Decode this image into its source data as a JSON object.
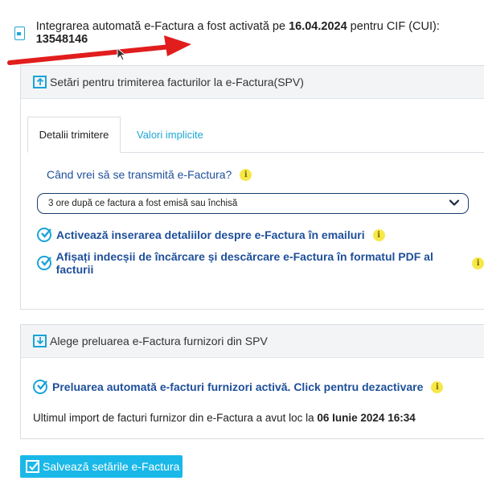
{
  "banner": {
    "text_prefix": "Integrarea automată e-Factura a fost activată pe ",
    "date": "16.04.2024",
    "text_mid": " pentru CIF (CUI): ",
    "cif": "13548146"
  },
  "send_panel": {
    "title": "Setări pentru trimiterea facturilor la e-Factura(SPV)",
    "tabs": [
      {
        "label": "Detalii trimitere",
        "active": true
      },
      {
        "label": "Valori implicite",
        "active": false
      }
    ],
    "question": "Când vrei să se transmită e-Factura?",
    "select_value": "3 ore după ce factura a fost emisă sau închisă",
    "options": [
      {
        "label": "Activează inserarea detaliilor despre e-Factura în emailuri",
        "checked": true
      },
      {
        "label": "Afișați indecșii de încărcare și descărcare e-Factura în formatul PDF al facturii",
        "checked": true
      }
    ]
  },
  "receive_panel": {
    "title": "Alege preluarea e-Factura furnizori din SPV",
    "status": "Preluarea automată e-facturi furnizori activă. Click pentru dezactivare",
    "last_import_prefix": "Ultimul import de facturi furnizor din e-Factura a avut loc la ",
    "last_import_date": "06 Iunie 2024 16:34"
  },
  "save_button": "Salvează setările e-Factura",
  "info_glyph": "i",
  "colors": {
    "accent": "#1aa4d8",
    "link_text": "#1e4f9a",
    "button_bg": "#1ab8e8",
    "info_badge": "#f7e84a",
    "arrow": "#e11d1d"
  }
}
